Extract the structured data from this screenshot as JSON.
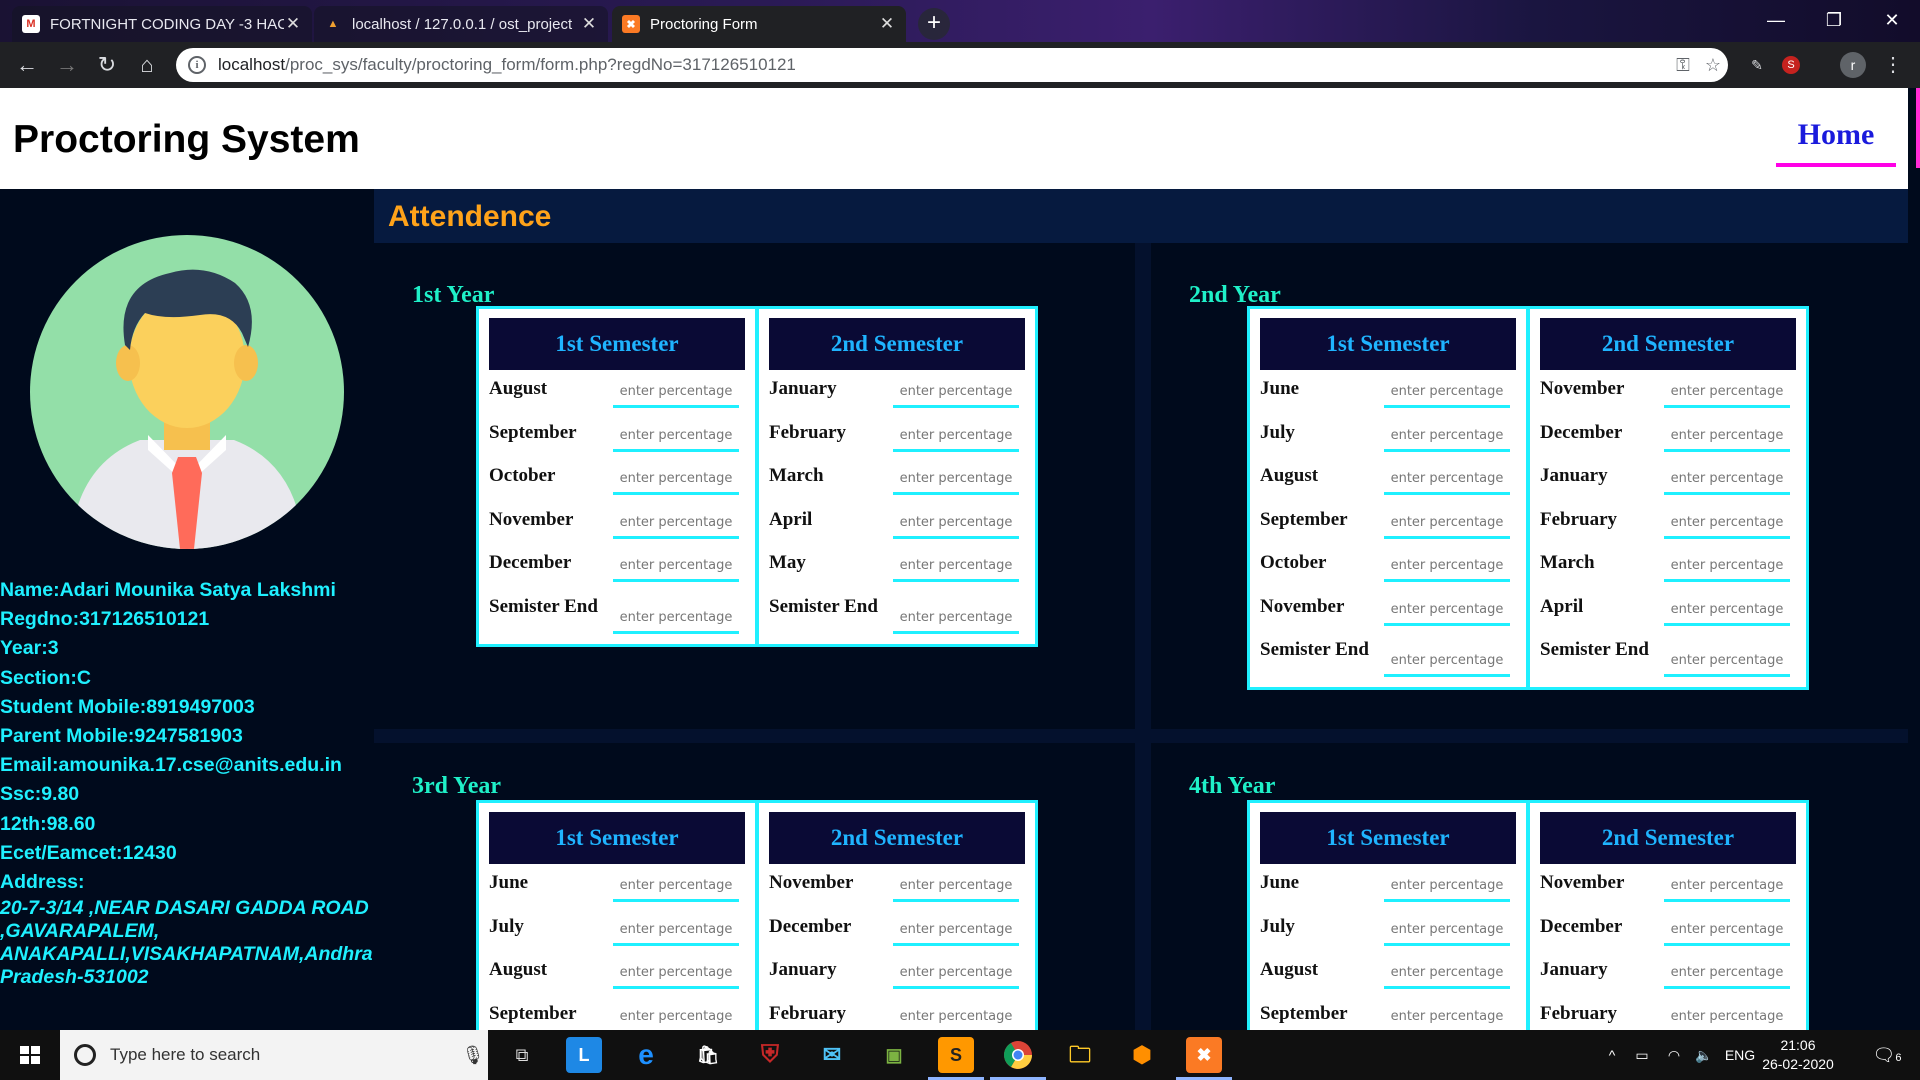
{
  "browser": {
    "tabs": [
      {
        "title": "FORTNIGHT CODING DAY -3 HAC",
        "favicon": "gmail-icon",
        "active": false
      },
      {
        "title": "localhost / 127.0.0.1 / ost_project",
        "favicon": "phpmyadmin-icon",
        "active": false
      },
      {
        "title": "Proctoring Form",
        "favicon": "xampp-icon",
        "active": true
      }
    ],
    "url_host": "localhost",
    "url_path": "/proc_sys/faculty/proctoring_form/form.php?regdNo=317126510121",
    "profile_initial": "r",
    "ext_badge": "S"
  },
  "header": {
    "title": "Proctoring System",
    "home_label": "Home"
  },
  "student": {
    "name": "Name:Adari Mounika Satya Lakshmi",
    "regdno": "Regdno:317126510121",
    "year": "Year:3",
    "section": "Section:C",
    "student_mobile": "Student Mobile:8919497003",
    "parent_mobile": "Parent Mobile:9247581903",
    "email": "Email:amounika.17.cse@anits.edu.in",
    "ssc": "Ssc:9.80",
    "twelfth": "12th:98.60",
    "ecet": "Ecet/Eamcet:12430",
    "address_label": "Address:",
    "address_1": "20-7-3/14 ,NEAR DASARI GADDA ROAD",
    "address_2": ",GAVARAPALEM,",
    "address_3": "ANAKAPALLI,VISAKHAPATNAM,Andhra",
    "address_4": "Pradesh-531002"
  },
  "attendance": {
    "section_title": "Attendence",
    "placeholder": "enter percentage",
    "years": [
      {
        "title": "1st Year",
        "semesters": [
          {
            "title": "1st Semester",
            "months": [
              "August",
              "September",
              "October",
              "November",
              "December"
            ],
            "end_label": "Semister End"
          },
          {
            "title": "2nd Semester",
            "months": [
              "January",
              "February",
              "March",
              "April",
              "May"
            ],
            "end_label": "Semister End"
          }
        ]
      },
      {
        "title": "2nd Year",
        "semesters": [
          {
            "title": "1st Semester",
            "months": [
              "June",
              "July",
              "August",
              "September",
              "October",
              "November"
            ],
            "end_label": "Semister End"
          },
          {
            "title": "2nd Semester",
            "months": [
              "November",
              "December",
              "January",
              "February",
              "March",
              "April"
            ],
            "end_label": "Semister End"
          }
        ]
      },
      {
        "title": "3rd Year",
        "semesters": [
          {
            "title": "1st Semester",
            "months": [
              "June",
              "July",
              "August",
              "September"
            ],
            "end_label": ""
          },
          {
            "title": "2nd Semester",
            "months": [
              "November",
              "December",
              "January",
              "February"
            ],
            "end_label": ""
          }
        ]
      },
      {
        "title": "4th Year",
        "semesters": [
          {
            "title": "1st Semester",
            "months": [
              "June",
              "July",
              "August",
              "September"
            ],
            "end_label": ""
          },
          {
            "title": "2nd Semester",
            "months": [
              "November",
              "December",
              "January",
              "February"
            ],
            "end_label": ""
          }
        ]
      }
    ]
  },
  "taskbar": {
    "search_placeholder": "Type here to search",
    "language": "ENG",
    "time": "21:06",
    "date": "26-02-2020",
    "notification_count": "6"
  },
  "colors": {
    "accent_cyan": "#1ff0ff",
    "title_orange": "#ffa31a",
    "semester_header": "#0a0a35",
    "home_link": "#1a1adc",
    "home_underline": "#ff00e6"
  }
}
